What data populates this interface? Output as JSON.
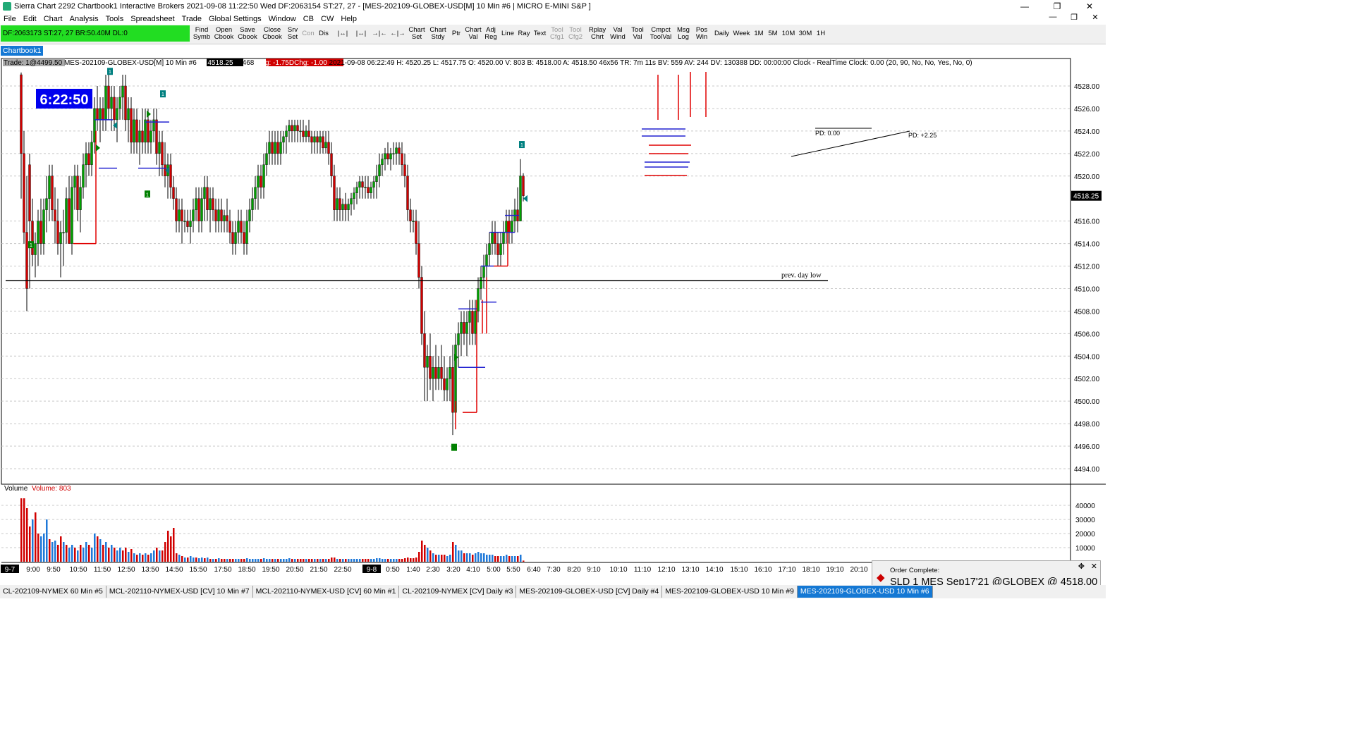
{
  "window": {
    "title": "Sierra Chart 2292 Chartbook1  Interactive Brokers 2021-09-08  11:22:50 Wed  DF:2063154  ST:27, 27  - [MES-202109-GLOBEX-USD[M]  10 Min  #6 | MICRO E-MINI S&P ]",
    "minimize": "—",
    "restore": "❐",
    "close": "✕"
  },
  "menu": {
    "items": [
      "File",
      "Edit",
      "Chart",
      "Analysis",
      "Tools",
      "Spreadsheet",
      "Trade",
      "Global Settings",
      "Window",
      "CB",
      "CW",
      "Help"
    ],
    "mdi_minimize": "—",
    "mdi_restore": "❐",
    "mdi_close": "✕"
  },
  "toolbar": {
    "status": "DF:2063173  ST:27, 27  BR:50.40M  DL:0",
    "buttons": [
      {
        "label": "Find\nSymb",
        "enabled": true
      },
      {
        "label": "Open\nCbook",
        "enabled": true
      },
      {
        "label": "Save\nCbook",
        "enabled": true
      },
      {
        "label": "Close\nCbook",
        "enabled": true
      },
      {
        "label": "Srv\nSet",
        "enabled": true
      },
      {
        "label": "Con",
        "enabled": false
      },
      {
        "label": "Dis",
        "enabled": true
      },
      {
        "label": "|↔|",
        "enabled": true
      },
      {
        "label": "|↔|",
        "enabled": true
      },
      {
        "label": "→|←",
        "enabled": true
      },
      {
        "label": "←|→",
        "enabled": true
      },
      {
        "label": "Chart\nSet",
        "enabled": true
      },
      {
        "label": "Chart\nStdy",
        "enabled": true
      },
      {
        "label": "Ptr",
        "enabled": true
      },
      {
        "label": "Chart\nVal",
        "enabled": true
      },
      {
        "label": "Adj\nReg",
        "enabled": true
      },
      {
        "label": "Line",
        "enabled": true
      },
      {
        "label": "Ray",
        "enabled": true
      },
      {
        "label": "Text",
        "enabled": true
      },
      {
        "label": "Tool\nCfg1",
        "enabled": false
      },
      {
        "label": "Tool\nCfg2",
        "enabled": false
      },
      {
        "label": "Rplay\nChrt",
        "enabled": true
      },
      {
        "label": "Val\nWind",
        "enabled": true
      },
      {
        "label": "Tool\nVal",
        "enabled": true
      },
      {
        "label": "Cmpct\nToolVal",
        "enabled": true
      },
      {
        "label": "Msg\nLog",
        "enabled": true
      },
      {
        "label": "Pos\nWin",
        "enabled": true
      },
      {
        "label": "Daily",
        "enabled": true
      },
      {
        "label": "Week",
        "enabled": true
      },
      {
        "label": "1M",
        "enabled": true
      },
      {
        "label": "5M",
        "enabled": true
      },
      {
        "label": "10M",
        "enabled": true
      },
      {
        "label": "30M",
        "enabled": true
      },
      {
        "label": "1H",
        "enabled": true
      }
    ]
  },
  "chartbook_tab": "Chartbook1",
  "chart": {
    "header_trade": "Trade: 1@4499.50",
    "header_symbol": "MES-202109-GLOBEX-USD[M]  10 Min   #6",
    "header_close": "C: 4518.25",
    "header_t": "T: 468",
    "header_chg": "Chg: -1.75",
    "header_dchg": "DChg: -1.00",
    "header_rest": "2021-09-08 06:22:49  H: 4520.25  L: 4517.75  O: 4520.00  V: 803  B: 4518.00  A: 4518.50  46x56  TR: 7m 11s  BV: 559  AV: 244  DV: 130388  DD: 00:00:00  Clock - RealTime  Clock: 0.00   (20, 90, No, No, Yes, No, 0)",
    "clock_display": "6:22:50",
    "last_price_label": "4518.25",
    "price_ticks": [
      "4528.00",
      "4526.00",
      "4524.00",
      "4522.00",
      "4520.00",
      "4516.00",
      "4514.00",
      "4512.00",
      "4510.00",
      "4508.00",
      "4506.00",
      "4504.00",
      "4502.00",
      "4500.00",
      "4498.00",
      "4496.00",
      "4494.00"
    ],
    "prev_day_low_label": "prev. day low",
    "pd_label_1": "PD: 0.00",
    "pd_label_2": "PD: +2.25",
    "marker_labels": [
      "1",
      "1",
      "1",
      "1",
      "1"
    ],
    "volume_title": "Volume",
    "volume_value": "Volume: 803",
    "volume_ticks": [
      "40000",
      "30000",
      "20000",
      "10000"
    ],
    "time_labels": [
      "9-7",
      "9:00",
      "9:50",
      "10:50",
      "11:50",
      "12:50",
      "13:50",
      "14:50",
      "15:50",
      "17:50",
      "18:50",
      "19:50",
      "20:50",
      "21:50",
      "22:50",
      "9-8",
      "0:50",
      "1:40",
      "2:30",
      "3:20",
      "4:10",
      "5:00",
      "5:50",
      "6:40",
      "7:30",
      "8:20",
      "9:10",
      "10:10",
      "11:10",
      "12:10",
      "13:10",
      "14:10",
      "15:10",
      "16:10",
      "17:10",
      "18:10",
      "19:10",
      "20:10"
    ],
    "colors": {
      "up": "#00a000",
      "down": "#d00000",
      "grid": "#c8c8c8",
      "vol_up": "#1e78d8",
      "vol_down": "#d00000"
    }
  },
  "bottom_tabs": [
    {
      "label": "CL-202109-NYMEX  60 Min  #5",
      "active": false
    },
    {
      "label": "MCL-202110-NYMEX-USD [CV]  10 Min  #7",
      "active": false
    },
    {
      "label": "MCL-202110-NYMEX-USD [CV]  60 Min  #1",
      "active": false
    },
    {
      "label": "CL-202109-NYMEX [CV]  Daily  #3",
      "active": false
    },
    {
      "label": "MES-202109-GLOBEX-USD [CV]  Daily  #4",
      "active": false
    },
    {
      "label": "MES-202109-GLOBEX-USD  10 Min  #9",
      "active": false
    },
    {
      "label": "MES-202109-GLOBEX-USD  10 Min  #6",
      "active": true
    }
  ],
  "toast": {
    "title": "Order Complete:",
    "message": "SLD 1 MES Sep17'21 @GLOBEX @ 4518.00",
    "icon": "alert-icon",
    "pin": "✥",
    "close": "✕"
  }
}
